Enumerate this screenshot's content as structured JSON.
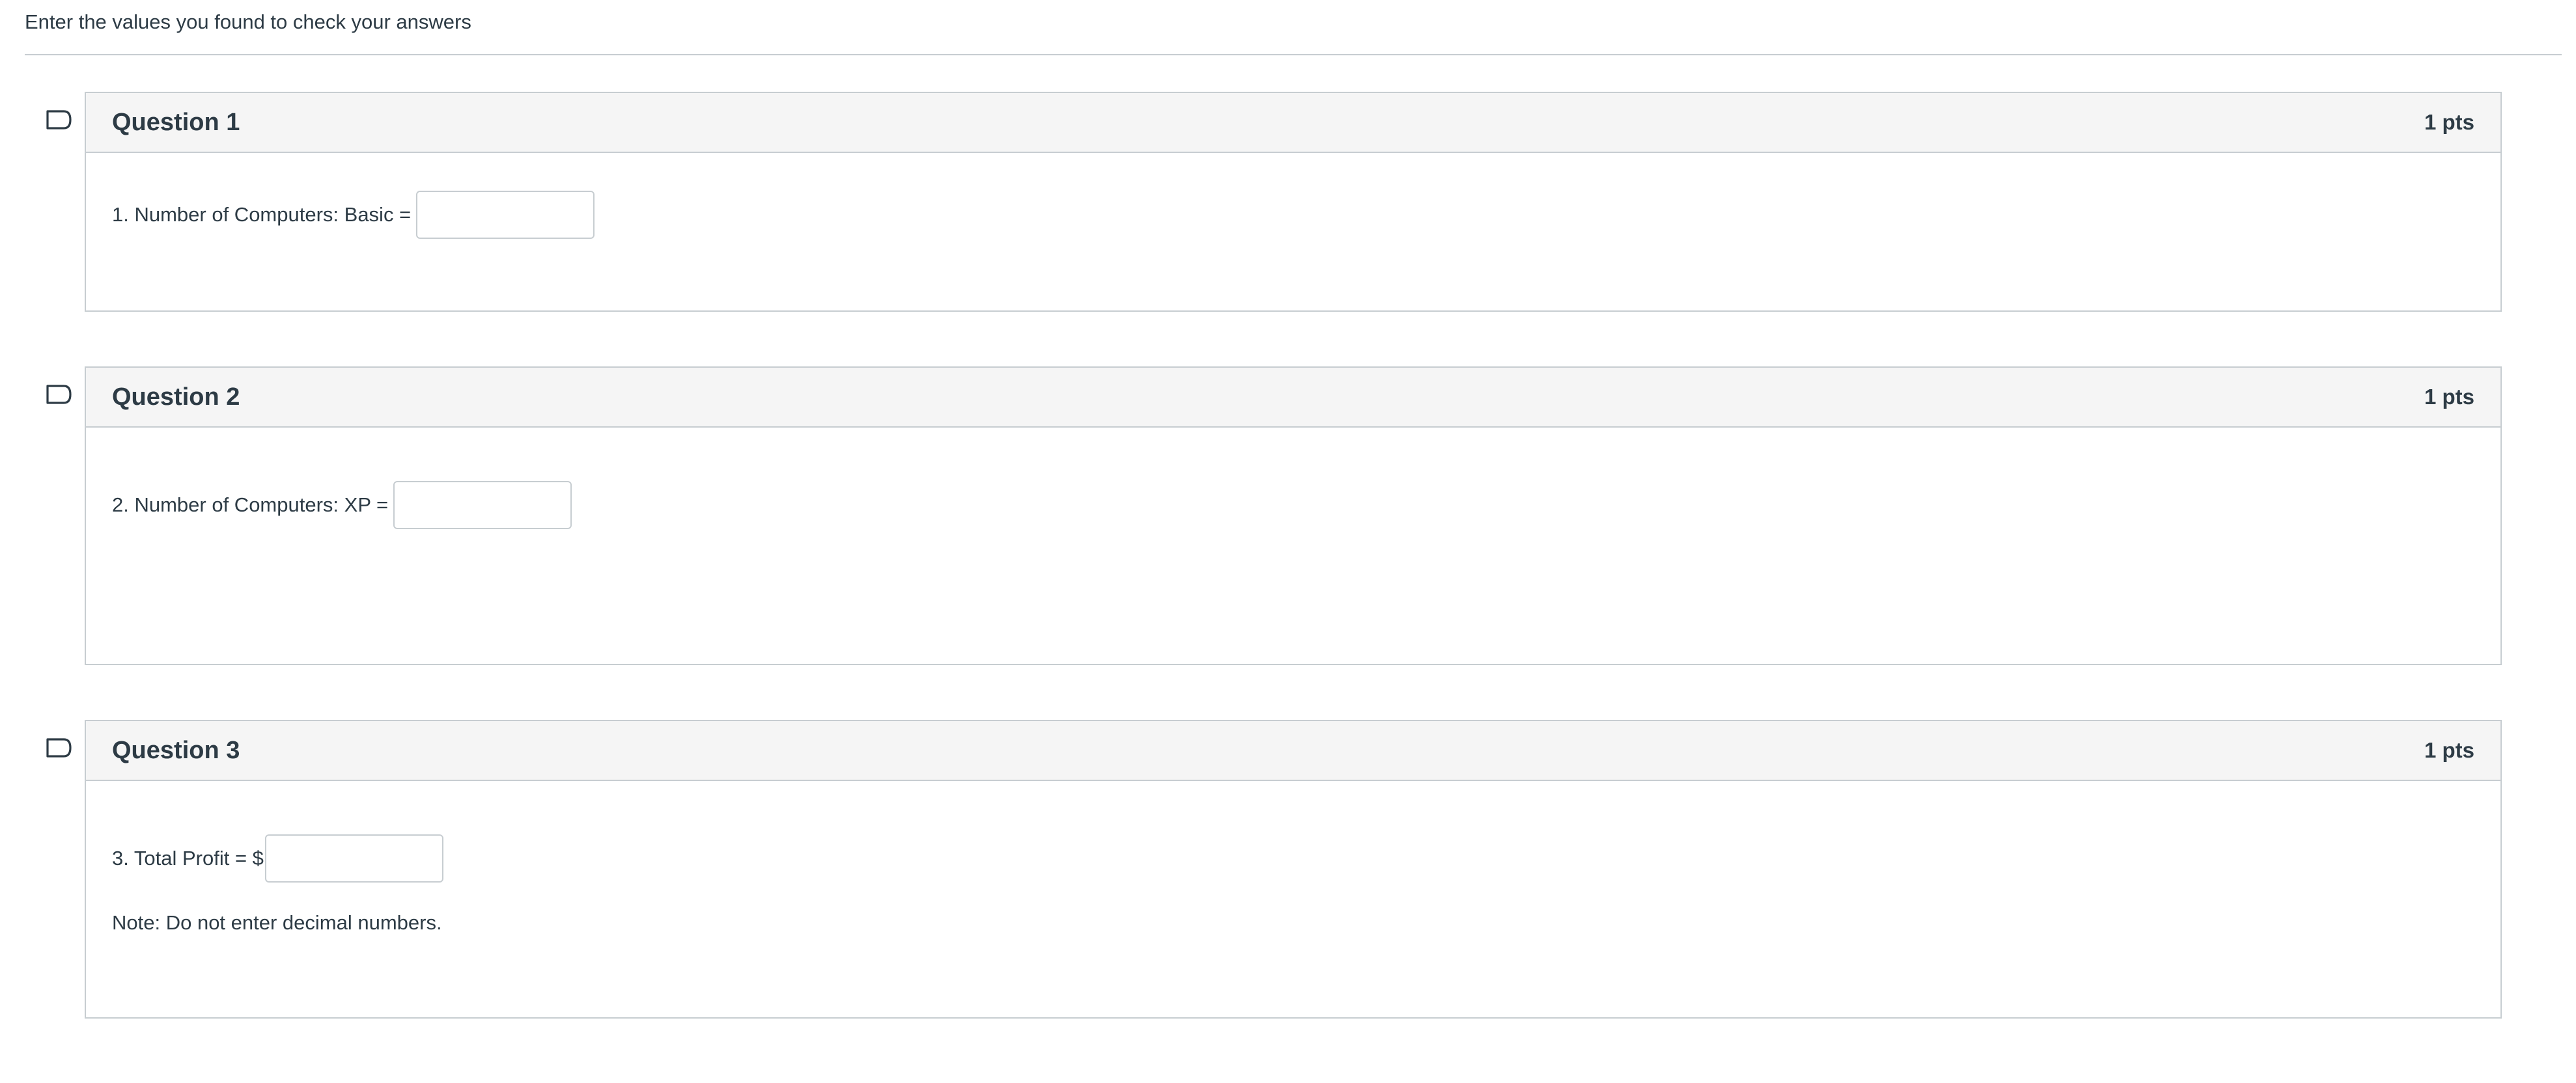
{
  "intro": {
    "text": "Enter the values you found to check your answers"
  },
  "questions": [
    {
      "title": "Question 1",
      "points": "1 pts",
      "prompt": "1. Number of Computers: Basic =",
      "answer": "",
      "flag_icon": "flag-outline-icon"
    },
    {
      "title": "Question 2",
      "points": "1 pts",
      "prompt": "2. Number of Computers: XP =",
      "answer": "",
      "flag_icon": "flag-outline-icon"
    },
    {
      "title": "Question 3",
      "points": "1 pts",
      "prompt": "3. Total Profit = $",
      "answer": "",
      "note": "Note: Do not enter decimal numbers.",
      "flag_icon": "flag-outline-icon"
    }
  ],
  "colors": {
    "border": "#c7cdd1",
    "header_bg": "#f5f5f5",
    "text": "#2d3b45",
    "flag": "#2d3b45"
  }
}
